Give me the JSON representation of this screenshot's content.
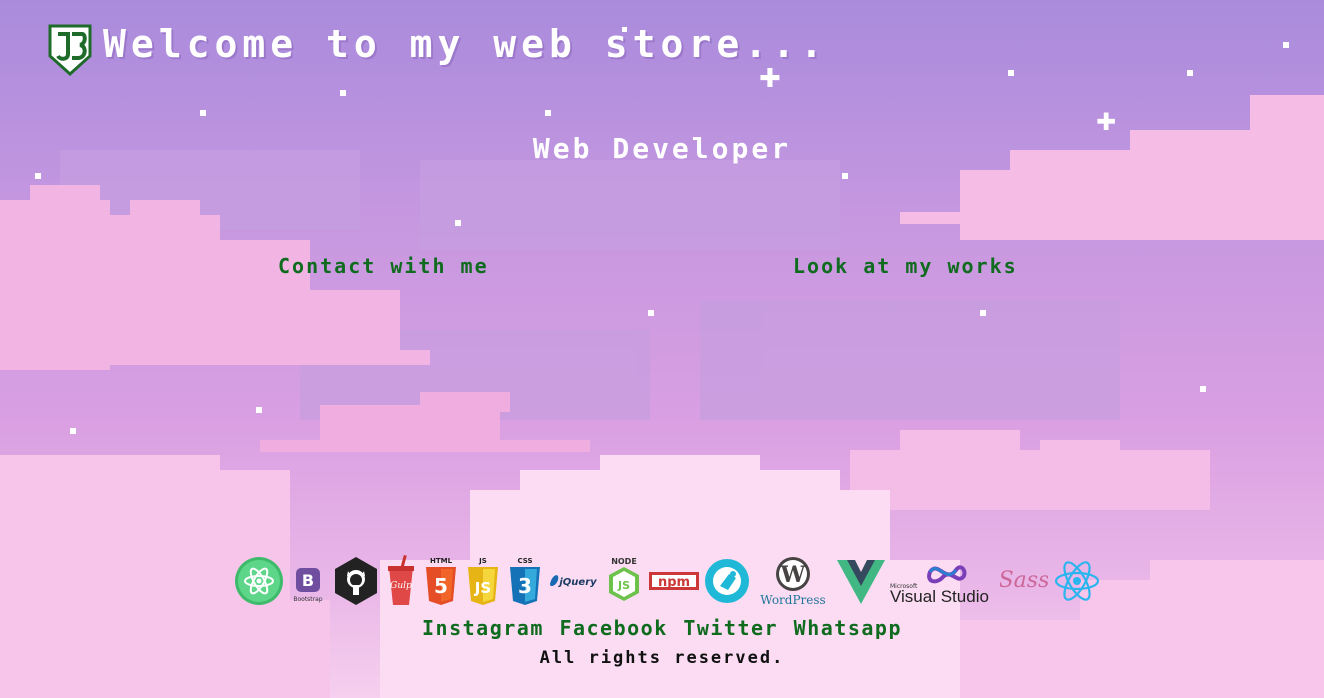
{
  "header": {
    "title": "Welcome to my web store...",
    "logo_icon": "shield-logo-icon"
  },
  "hero": {
    "subtitle": "Web Developer"
  },
  "nav": {
    "contact_label": "Contact with me",
    "works_label": "Look at my works"
  },
  "tech_icons": [
    "atom-icon",
    "bootstrap-icon",
    "github-icon",
    "gulp-icon",
    "html5-icon",
    "js-icon",
    "css3-icon",
    "jquery-icon",
    "nodejs-icon",
    "npm-icon",
    "postman-icon",
    "wordpress-icon",
    "vue-icon",
    "visual-studio-icon",
    "sass-icon",
    "react-icon"
  ],
  "tech_labels": {
    "bootstrap": "Bootstrap",
    "gulp": "Gulp",
    "html": "HTML",
    "js": "JS",
    "css": "CSS",
    "jquery": "jQuery",
    "node": "NODE",
    "npm": "npm",
    "wordpress": "WordPress",
    "vs_small": "Microsoft",
    "vs_big": "Visual Studio",
    "sass": "Sass"
  },
  "footer": {
    "social": [
      "Instagram",
      "Facebook",
      "Twitter",
      "Whatsapp"
    ],
    "copyright": "All rights reserved."
  },
  "colors": {
    "link_green": "#0f6b1e",
    "sky_top": "#a98bdc",
    "cloud_pink": "#f3b6e4"
  }
}
